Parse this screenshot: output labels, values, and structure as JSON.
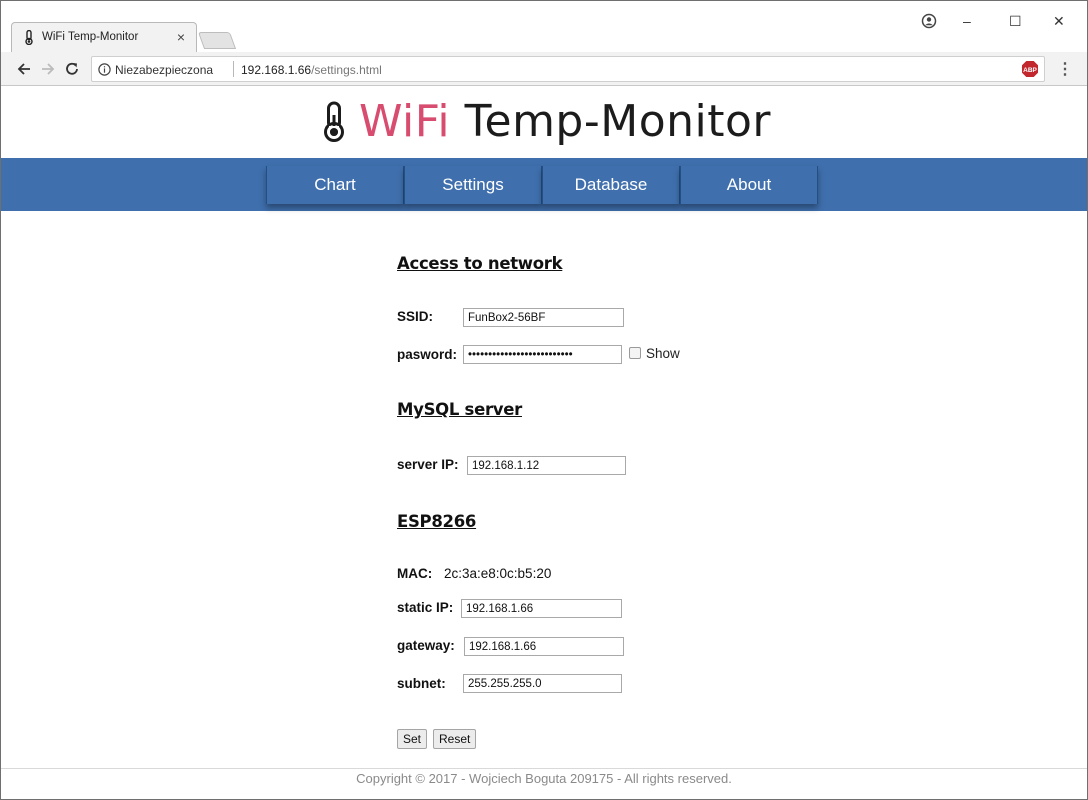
{
  "browser": {
    "tab_title": "WiFi Temp-Monitor",
    "tab_close": "×",
    "security_label": "Niezabezpieczona",
    "url_host": "192.168.1.66",
    "url_path": "/settings.html",
    "abp_label": "ABP",
    "minimize": "–",
    "maximize": "☐",
    "close": "✕",
    "star": "☆",
    "menu": "⋮",
    "icons": [
      "account-icon",
      "back-arrow-icon",
      "forward-arrow-icon",
      "reload-icon",
      "info-icon",
      "star-icon",
      "adblock-icon",
      "menu-icon"
    ]
  },
  "header": {
    "title_accent": "WiFi",
    "title_rest": " Temp-Monitor",
    "accent_color": "#d84d6f",
    "icon": "thermometer-icon"
  },
  "nav": {
    "bar_color": "#3f6fad",
    "items": [
      {
        "label": "Chart"
      },
      {
        "label": "Settings"
      },
      {
        "label": "Database"
      },
      {
        "label": "About"
      }
    ]
  },
  "network": {
    "heading": "Access to network",
    "ssid_label": "SSID:",
    "ssid_value": "FunBox2-56BF",
    "password_label": "pasword:",
    "password_value": "••••••••••••••••••••••••••",
    "show_label": "Show"
  },
  "mysql": {
    "heading": "MySQL server",
    "server_ip_label": "server IP:",
    "server_ip_value": "192.168.1.12"
  },
  "esp": {
    "heading": "ESP8266",
    "mac_label": "MAC:",
    "mac_value": "2c:3a:e8:0c:b5:20",
    "static_ip_label": "static IP:",
    "static_ip_value": "192.168.1.66",
    "gateway_label": "gateway:",
    "gateway_value": "192.168.1.66",
    "subnet_label": "subnet:",
    "subnet_value": "255.255.255.0"
  },
  "buttons": {
    "set": "Set",
    "reset": "Reset"
  },
  "footer": {
    "text": "Copyright © 2017 - Wojciech Boguta 209175 - All rights reserved."
  }
}
